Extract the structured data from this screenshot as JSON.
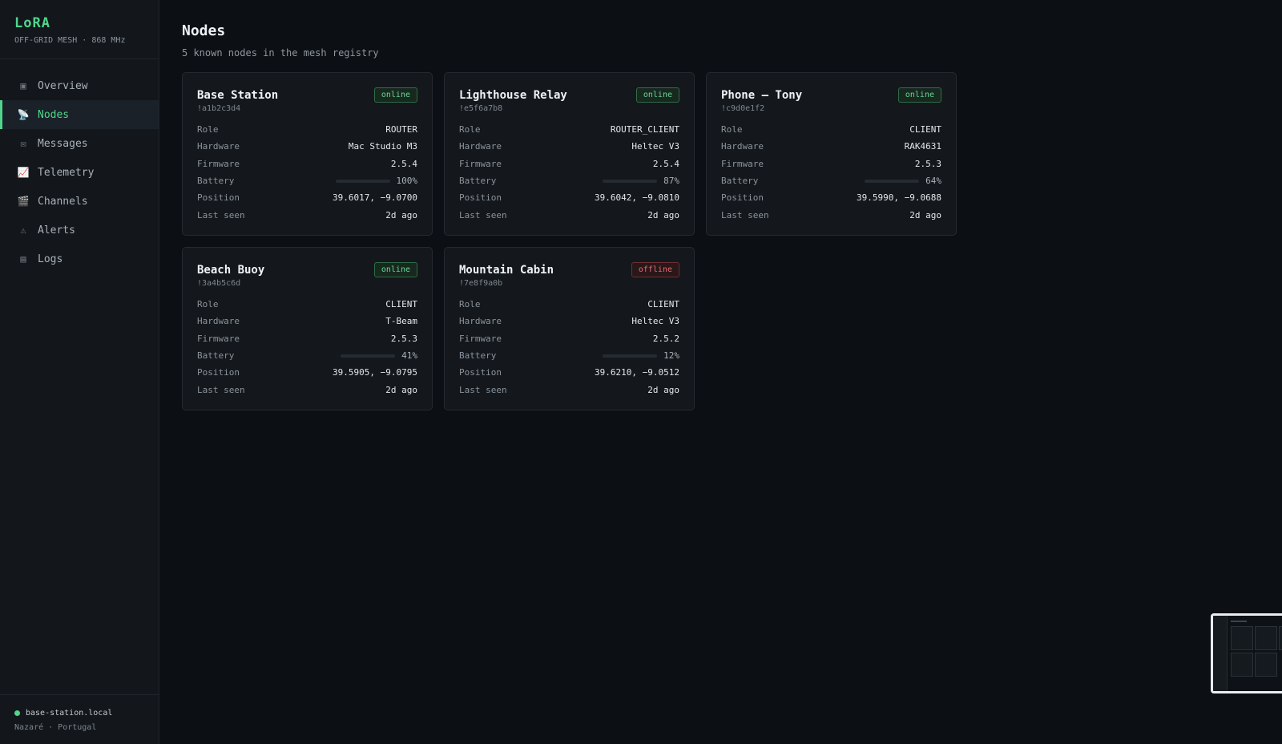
{
  "sidebar": {
    "brand_title": "LoRA",
    "brand_sub": "OFF-GRID MESH · 868 MHz",
    "items": [
      {
        "label": "Overview",
        "icon": "▣",
        "active": false
      },
      {
        "label": "Nodes",
        "icon": "📡",
        "active": true
      },
      {
        "label": "Messages",
        "icon": "✉",
        "active": false
      },
      {
        "label": "Telemetry",
        "icon": "📈",
        "active": false
      },
      {
        "label": "Channels",
        "icon": "🎬",
        "active": false
      },
      {
        "label": "Alerts",
        "icon": "⚠",
        "active": false
      },
      {
        "label": "Logs",
        "icon": "▤",
        "active": false
      }
    ],
    "footer": {
      "host": "base-station.local",
      "location": "Nazaré · Portugal",
      "status_color": "#4fd68b"
    }
  },
  "header": {
    "title": "Nodes",
    "subtitle": "5 known nodes in the mesh registry"
  },
  "labels": {
    "role": "Role",
    "hardware": "Hardware",
    "firmware": "Firmware",
    "battery": "Battery",
    "position": "Position",
    "last_seen": "Last seen"
  },
  "nodes": [
    {
      "name": "Base Station",
      "id": "!a1b2c3d4",
      "status": "online",
      "role": "ROUTER",
      "hardware": "Mac Studio M3",
      "firmware": "2.5.4",
      "battery": 100,
      "battery_label": "100%",
      "battery_color": "#5bd68e",
      "position": "39.6017, −9.0700",
      "last_seen": "2d ago"
    },
    {
      "name": "Lighthouse Relay",
      "id": "!e5f6a7b8",
      "status": "online",
      "role": "ROUTER_CLIENT",
      "hardware": "Heltec V3",
      "firmware": "2.5.4",
      "battery": 87,
      "battery_label": "87%",
      "battery_color": "#5bd68e",
      "position": "39.6042, −9.0810",
      "last_seen": "2d ago"
    },
    {
      "name": "Phone — Tony",
      "id": "!c9d0e1f2",
      "status": "online",
      "role": "CLIENT",
      "hardware": "RAK4631",
      "firmware": "2.5.3",
      "battery": 64,
      "battery_label": "64%",
      "battery_color": "#5bd68e",
      "position": "39.5990, −9.0688",
      "last_seen": "2d ago"
    },
    {
      "name": "Beach Buoy",
      "id": "!3a4b5c6d",
      "status": "online",
      "role": "CLIENT",
      "hardware": "T-Beam",
      "firmware": "2.5.3",
      "battery": 41,
      "battery_label": "41%",
      "battery_color": "#e8a93e",
      "position": "39.5905, −9.0795",
      "last_seen": "2d ago"
    },
    {
      "name": "Mountain Cabin",
      "id": "!7e8f9a0b",
      "status": "offline",
      "role": "CLIENT",
      "hardware": "Heltec V3",
      "firmware": "2.5.2",
      "battery": 12,
      "battery_label": "12%",
      "battery_color": "#e35a5a",
      "position": "39.6210, −9.0512",
      "last_seen": "2d ago"
    }
  ]
}
